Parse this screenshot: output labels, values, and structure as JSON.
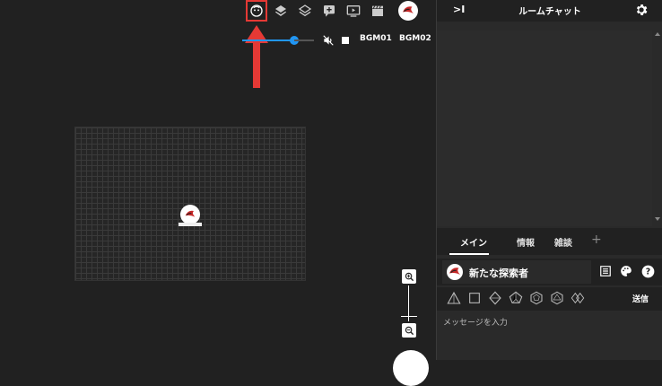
{
  "toolbar": {
    "icons": [
      "face-icon",
      "layers-filled-icon",
      "layers-outline-icon",
      "add-comment-icon",
      "video-icon",
      "clapperboard-icon",
      "profile-avatar"
    ]
  },
  "audio": {
    "volume": 0.72,
    "bgm1": "BGM01",
    "bgm2": "BGM02"
  },
  "panel": {
    "collapse": ">I",
    "title": "ルームチャット"
  },
  "tabs": {
    "main": "メイン",
    "info": "情報",
    "chat": "雑談",
    "add": "+"
  },
  "sender": {
    "name": "新たな探索者"
  },
  "send": {
    "label": "送信"
  },
  "input": {
    "placeholder": "メッセージを入力"
  },
  "colors": {
    "accent": "#2196f3",
    "highlight": "#e53935",
    "background": "#212121"
  }
}
